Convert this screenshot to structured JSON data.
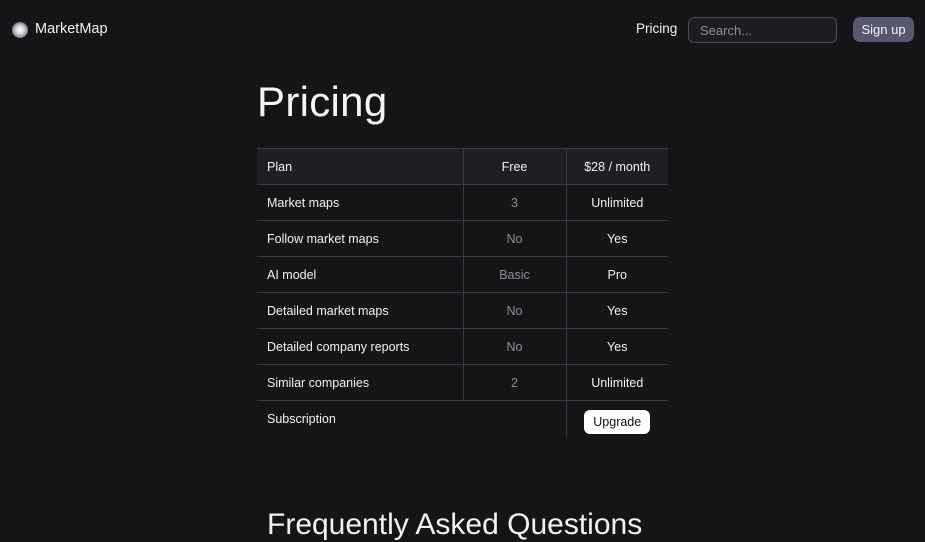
{
  "header": {
    "logo_icon": "sphere-logo-icon",
    "brand": "MarketMap",
    "nav_pricing": "Pricing",
    "search_placeholder": "Search...",
    "signup_label": "Sign up"
  },
  "main": {
    "title": "Pricing",
    "table": {
      "headers": [
        "Plan",
        "Free",
        "$28 / month"
      ],
      "rows": [
        [
          "Market maps",
          "3",
          "Unlimited"
        ],
        [
          "Follow market maps",
          "No",
          "Yes"
        ],
        [
          "AI model",
          "Basic",
          "Pro"
        ],
        [
          "Detailed market maps",
          "No",
          "Yes"
        ],
        [
          "Detailed company reports",
          "No",
          "Yes"
        ],
        [
          "Similar companies",
          "2",
          "Unlimited"
        ]
      ],
      "subscription_label": "Subscription",
      "upgrade_label": "Upgrade"
    },
    "faq_title": "Frequently Asked Questions"
  },
  "colors": {
    "background": "#151417",
    "signup_button": "#585770",
    "upgrade_button": "#ffffff"
  }
}
